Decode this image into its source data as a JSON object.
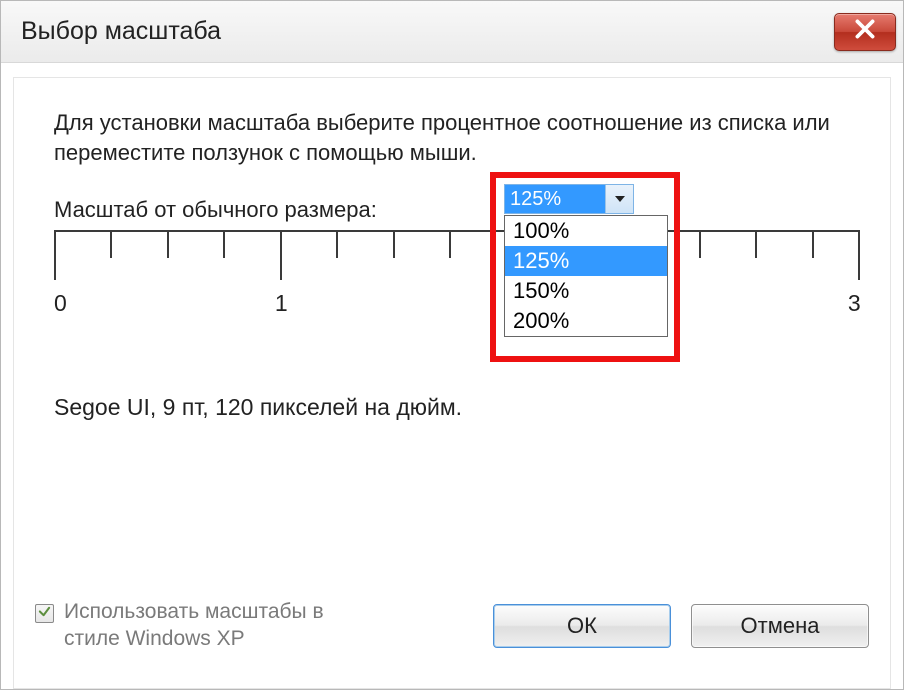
{
  "title": "Выбор масштаба",
  "instructions": "Для установки масштаба выберите процентное соотношение из списка или переместите ползунок с помощью мыши.",
  "scale_label": "Масштаб от обычного размера:",
  "combo": {
    "value": "125%",
    "options": [
      "100%",
      "125%",
      "150%",
      "200%"
    ],
    "selected_index": 1
  },
  "ruler": {
    "labels": [
      "0",
      "1",
      "3"
    ]
  },
  "font_info": "Segoe UI, 9 пт, 120 пикселей на дюйм.",
  "checkbox": {
    "line1": "Использовать масштабы в",
    "line2": "стиле Windows XP",
    "checked": true
  },
  "buttons": {
    "ok": "ОК",
    "cancel": "Отмена"
  }
}
